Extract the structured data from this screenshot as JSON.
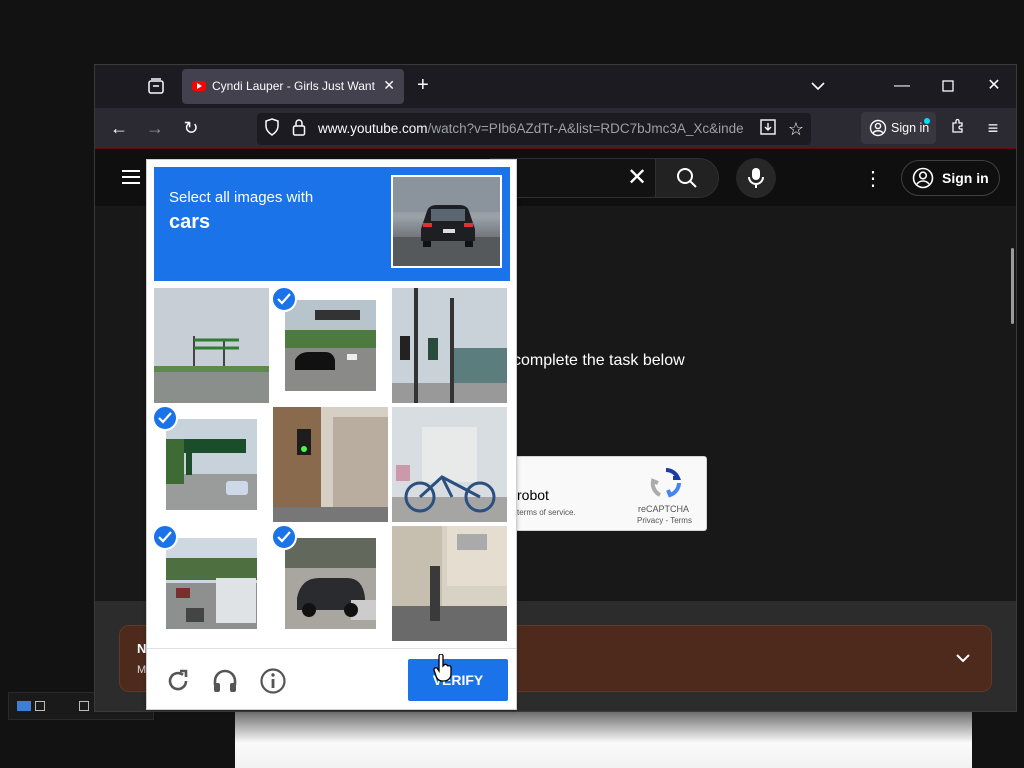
{
  "browser": {
    "tab_title": "Cyndi Lauper - Girls Just Want T",
    "url_domain": "www.youtube.com",
    "url_path": "/watch?v=PIb6AZdTr-A&list=RDC7bJmc3A_Xc&inde",
    "signin_label": "Sign in"
  },
  "youtube": {
    "signin_label": "Sign in",
    "task_text": "complete the task below",
    "notice_title": "N",
    "notice_sub": "M"
  },
  "recaptcha_box": {
    "robot_text": "robot",
    "tos_text": "terms of service.",
    "brand": "reCAPTCHA",
    "privacy_terms": "Privacy - Terms"
  },
  "captcha": {
    "instruction": "Select all images with",
    "target": "cars",
    "verify_label": "VERIFY",
    "tiles": [
      {
        "selected": false
      },
      {
        "selected": true
      },
      {
        "selected": false
      },
      {
        "selected": true
      },
      {
        "selected": false
      },
      {
        "selected": false
      },
      {
        "selected": true
      },
      {
        "selected": true
      },
      {
        "selected": false
      }
    ]
  },
  "colors": {
    "captcha_blue": "#1a73e8",
    "notice_brown": "#4d2a1c"
  }
}
